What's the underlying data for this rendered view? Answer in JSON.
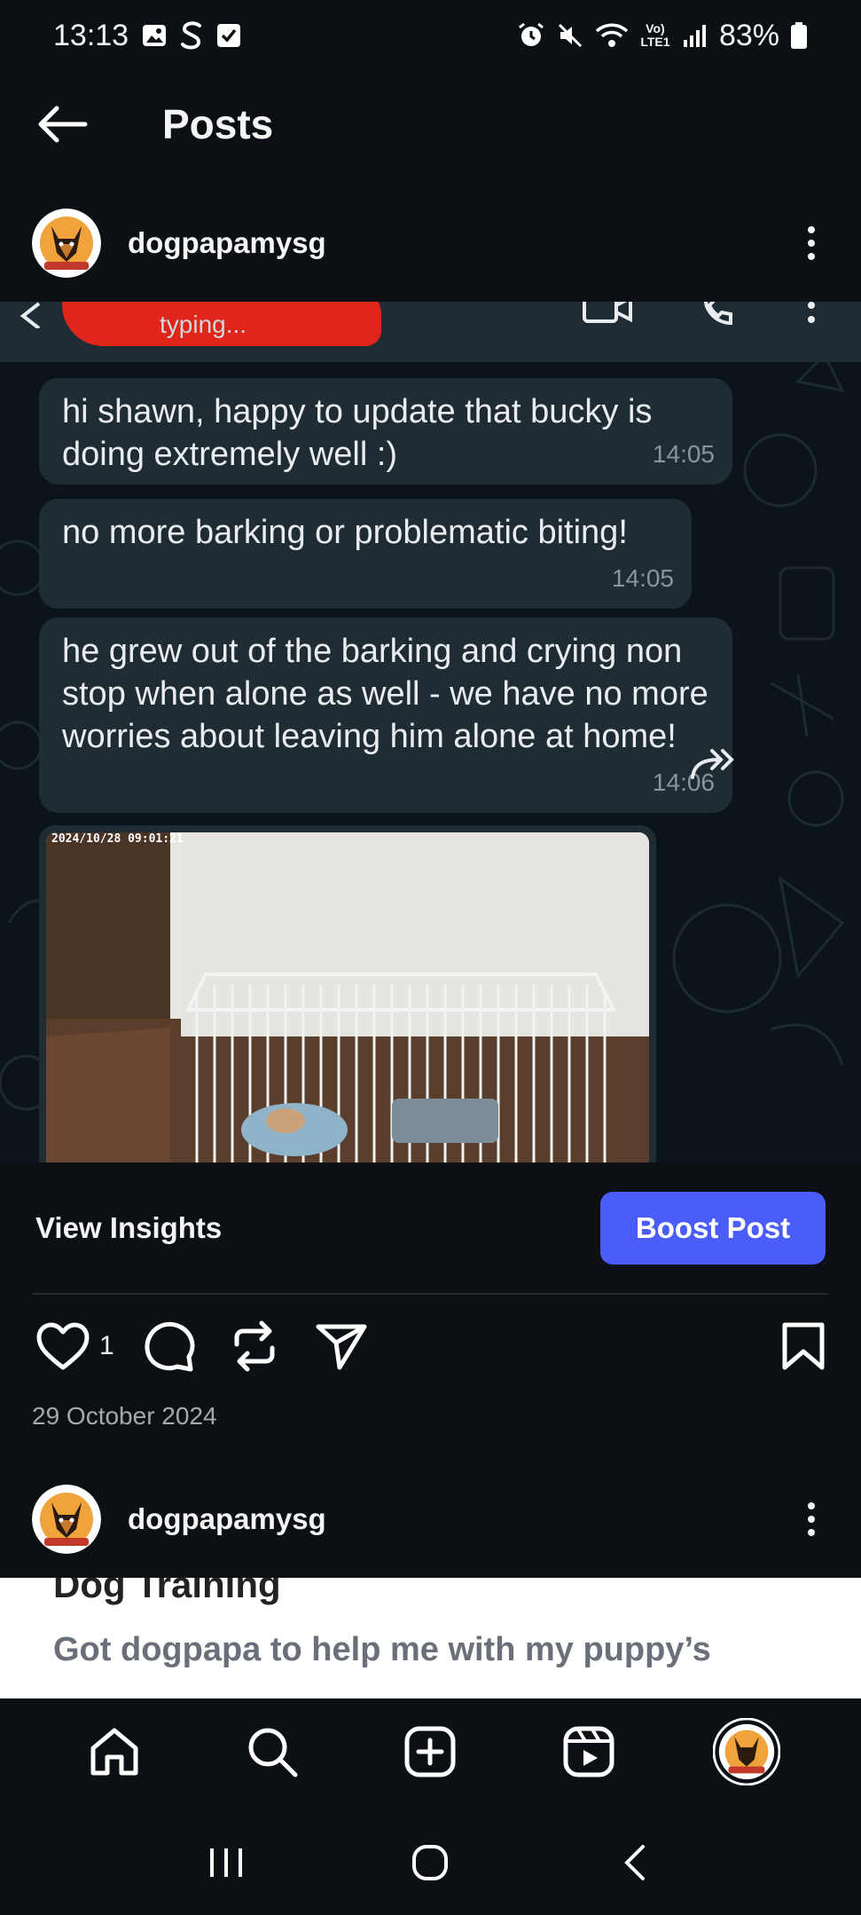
{
  "status_bar": {
    "time": "13:13",
    "battery": "83%",
    "network": "Vo) LTE1"
  },
  "header": {
    "title": "Posts"
  },
  "post": {
    "username": "dogpapamysg",
    "media": {
      "typing": "typing...",
      "messages": [
        {
          "text": "hi shawn, happy to update that bucky is doing extremely well :)",
          "time": "14:05"
        },
        {
          "text": "no more barking or problematic biting!",
          "time": "14:05"
        },
        {
          "text": "he grew out of the barking and crying non stop when alone as well - we have no more worries about leaving him alone at home!",
          "time": "14:06"
        }
      ],
      "camera_timestamp": "2024/10/28 09:01:21"
    },
    "view_insights": "View Insights",
    "boost_label": "Boost Post",
    "like_count": "1",
    "date": "29 October 2024"
  },
  "post2": {
    "username": "dogpapamysg",
    "heading": "Dog Training",
    "text": "Got dogpapa to help me with my puppy’s"
  },
  "colors": {
    "accent": "#4a5df9",
    "background": "#0c1014",
    "bubble": "#1f2c34"
  }
}
